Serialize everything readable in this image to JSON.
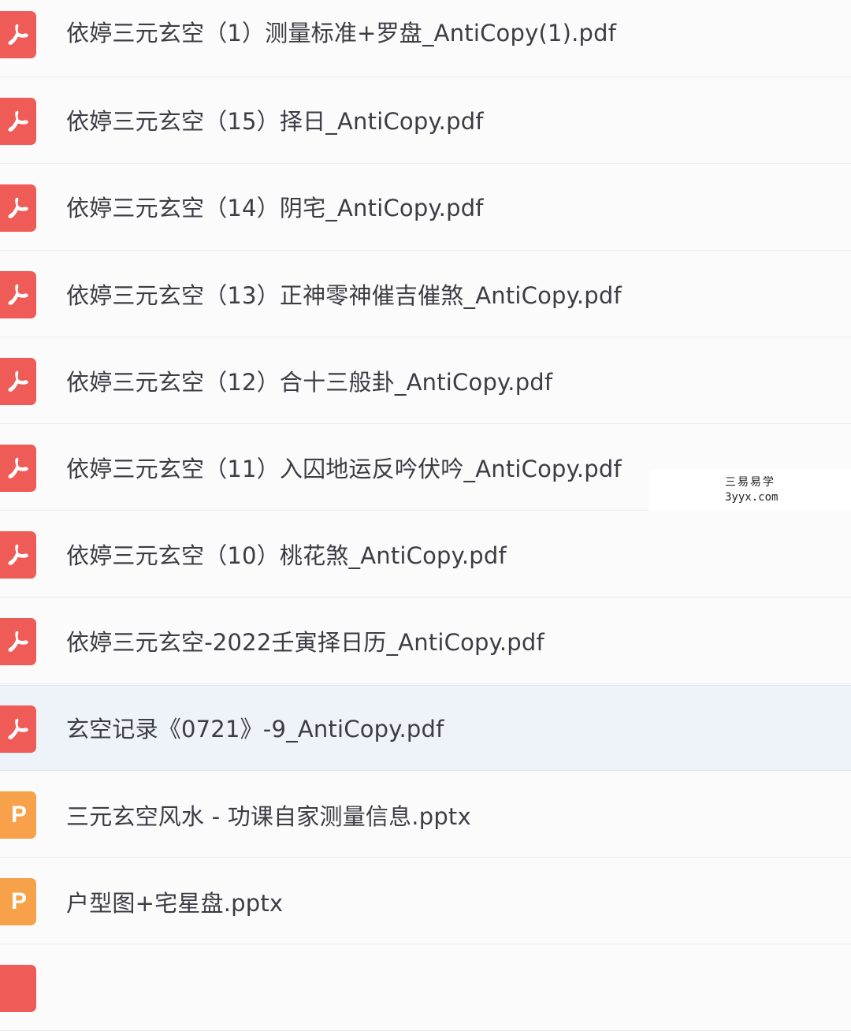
{
  "files": [
    {
      "name": "依婷三元玄空（1）测量标准+罗盘_AntiCopy(1).pdf",
      "type": "pdf",
      "icon": "pdf-file-icon"
    },
    {
      "name": "依婷三元玄空（15）择日_AntiCopy.pdf",
      "type": "pdf",
      "icon": "pdf-file-icon"
    },
    {
      "name": "依婷三元玄空（14）阴宅_AntiCopy.pdf",
      "type": "pdf",
      "icon": "pdf-file-icon"
    },
    {
      "name": "依婷三元玄空（13）正神零神催吉催煞_AntiCopy.pdf",
      "type": "pdf",
      "icon": "pdf-file-icon"
    },
    {
      "name": "依婷三元玄空（12）合十三般卦_AntiCopy.pdf",
      "type": "pdf",
      "icon": "pdf-file-icon"
    },
    {
      "name": "依婷三元玄空（11）入囚地运反吟伏吟_AntiCopy.pdf",
      "type": "pdf",
      "icon": "pdf-file-icon"
    },
    {
      "name": "依婷三元玄空（10）桃花煞_AntiCopy.pdf",
      "type": "pdf",
      "icon": "pdf-file-icon"
    },
    {
      "name": "依婷三元玄空-2022壬寅择日历_AntiCopy.pdf",
      "type": "pdf",
      "icon": "pdf-file-icon"
    },
    {
      "name": "玄空记录《0721》-9_AntiCopy.pdf",
      "type": "pdf",
      "icon": "pdf-file-icon",
      "selected": true
    },
    {
      "name": "三元玄空风水 - 功课自家测量信息.pptx",
      "type": "pptx",
      "icon": "pptx-file-icon",
      "glyph": "P"
    },
    {
      "name": "户型图+宅星盘.pptx",
      "type": "pptx",
      "icon": "pptx-file-icon",
      "glyph": "P"
    }
  ],
  "watermark": {
    "line1": "三易易学",
    "line2": "3yyx.com"
  },
  "colors": {
    "pdf_icon": "#ef5b56",
    "pptx_icon": "#f7a24a",
    "selected_row": "#eef3f9",
    "text": "#3c3c44"
  }
}
